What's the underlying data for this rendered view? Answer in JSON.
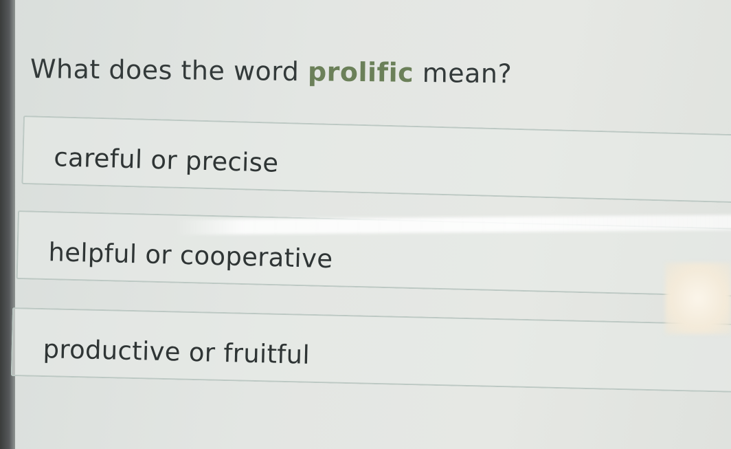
{
  "question": {
    "prefix": "What does the word ",
    "keyword": "prolific",
    "suffix": " mean?"
  },
  "options": [
    {
      "label": "careful or precise"
    },
    {
      "label": "helpful or cooperative"
    },
    {
      "label": "productive or fruitful"
    }
  ],
  "colors": {
    "keyword": "#6b8059",
    "text": "#333a3a",
    "option_border": "#bcc8c3"
  }
}
